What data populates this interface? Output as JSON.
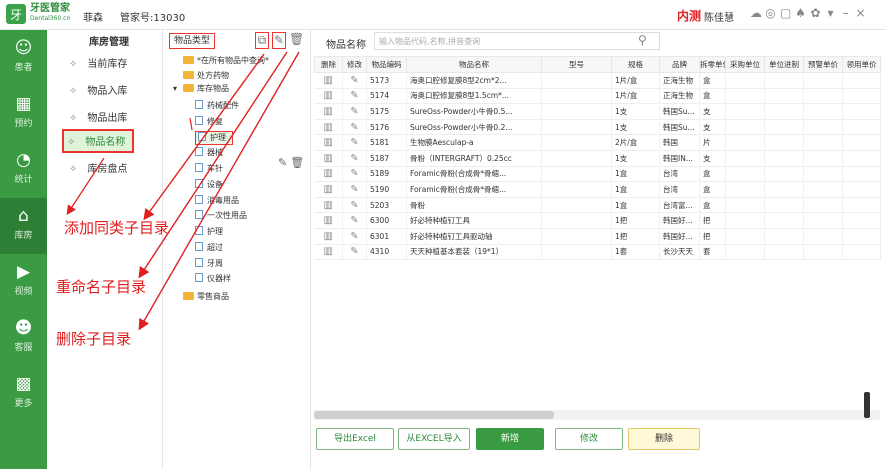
{
  "titlebar": {
    "logo_mark": "牙",
    "logo_name": "牙医管家",
    "logo_domain": "Dental360.cn",
    "user_name": "菲森",
    "manager_id": "管家号:13030",
    "net_status": "内测",
    "account_name": "陈佳慧",
    "icons": [
      "chat-icon",
      "camera-icon",
      "screen-icon",
      "bell-icon",
      "settings-icon",
      "dropdown-icon",
      "minimize-icon",
      "close-icon"
    ]
  },
  "sidebar": {
    "items": [
      {
        "label": "患者",
        "icon": "person-icon",
        "glyph": "☺"
      },
      {
        "label": "预约",
        "icon": "calendar-icon",
        "glyph": "▦"
      },
      {
        "label": "统计",
        "icon": "pie-icon",
        "glyph": "◔"
      },
      {
        "label": "库房",
        "icon": "warehouse-icon",
        "glyph": "⌂"
      },
      {
        "label": "视频",
        "icon": "play-icon",
        "glyph": "▶"
      },
      {
        "label": "客服",
        "icon": "service-icon",
        "glyph": "☻"
      },
      {
        "label": "更多",
        "icon": "grid-icon",
        "glyph": "▩"
      }
    ]
  },
  "menu": {
    "title": "库房管理",
    "items": [
      "当前库存",
      "物品入库",
      "物品出库",
      "物品名称",
      "库房盘点"
    ]
  },
  "tree": {
    "title": "物品类型",
    "nodes": [
      {
        "label": "*在所有物品中查询*",
        "kind": "folder"
      },
      {
        "label": "处方药物",
        "kind": "folder"
      },
      {
        "label": "库存物品",
        "kind": "folder"
      },
      {
        "label": "药械配件",
        "kind": "file"
      },
      {
        "label": "修复",
        "kind": "file"
      },
      {
        "label": "护理",
        "kind": "file"
      },
      {
        "label": "器械",
        "kind": "file"
      },
      {
        "label": "车针",
        "kind": "file"
      },
      {
        "label": "设备",
        "kind": "file"
      },
      {
        "label": "消毒用品",
        "kind": "file"
      },
      {
        "label": "一次性用品",
        "kind": "file"
      },
      {
        "label": "护理",
        "kind": "file"
      },
      {
        "label": "超过",
        "kind": "file"
      },
      {
        "label": "牙周",
        "kind": "file"
      },
      {
        "label": "仪器样",
        "kind": "file"
      },
      {
        "label": "零售商品",
        "kind": "folder"
      }
    ]
  },
  "search": {
    "label": "物品名称",
    "placeholder": "输入物品代码,名称,拼音查询"
  },
  "table": {
    "columns": [
      "删除",
      "修改",
      "物品编码",
      "物品名称",
      "型号",
      "规格",
      "品牌",
      "拆零单位",
      "采购单位",
      "单位进制",
      "预警单价",
      "领用单价"
    ],
    "rows": [
      {
        "code": "5173",
        "name": "海奥口腔修复膜8型2cm*2...",
        "model": "",
        "spec": "1片/盒",
        "brand": "正海生物",
        "unit": "盒"
      },
      {
        "code": "5174",
        "name": "海奥口腔修复膜8型1.5cm*...",
        "model": "",
        "spec": "1片/盒",
        "brand": "正海生物",
        "unit": "盒"
      },
      {
        "code": "5175",
        "name": "SureOss-Powder小牛骨0.5...",
        "model": "",
        "spec": "1支",
        "brand": "韩国Su...",
        "unit": "支"
      },
      {
        "code": "5176",
        "name": "SureOss-Powder小牛骨0.2...",
        "model": "",
        "spec": "1支",
        "brand": "韩国Su...",
        "unit": "支"
      },
      {
        "code": "5181",
        "name": "生物膜Aesculap-a",
        "model": "",
        "spec": "2片/盒",
        "brand": "韩国",
        "unit": "片"
      },
      {
        "code": "5187",
        "name": "骨粉（INTERGRAFT）0.25cc",
        "model": "",
        "spec": "1支",
        "brand": "韩国IN...",
        "unit": "支"
      },
      {
        "code": "5189",
        "name": "Foramic骨粉(合成骨*骨缩...",
        "model": "",
        "spec": "1盒",
        "brand": "台湾",
        "unit": "盒"
      },
      {
        "code": "5190",
        "name": "Foramic骨粉(合成骨*骨缩...",
        "model": "",
        "spec": "1盒",
        "brand": "台湾",
        "unit": "盒"
      },
      {
        "code": "5203",
        "name": "骨粉",
        "model": "",
        "spec": "1盒",
        "brand": "台湾富...",
        "unit": "盒"
      },
      {
        "code": "6300",
        "name": "好必特种植钉工具",
        "model": "",
        "spec": "1把",
        "brand": "韩国好...",
        "unit": "把"
      },
      {
        "code": "6301",
        "name": "好必特种植钉工具驱动轴",
        "model": "",
        "spec": "1把",
        "brand": "韩国好...",
        "unit": "把"
      },
      {
        "code": "4310",
        "name": "天天种植基本套装（19*1）",
        "model": "",
        "spec": "1套",
        "brand": "长沙天天",
        "unit": "套"
      }
    ]
  },
  "actions": {
    "export_excel": "导出Excel",
    "import_excel": "从EXCEL导入",
    "add": "新增",
    "edit": "修改",
    "delete": "删除"
  },
  "annotations": {
    "add_sibling": "添加同类子目录",
    "rename": "重命名子目录",
    "delete_child": "删除子目录"
  },
  "colors": {
    "brand_green": "#3b9b43",
    "annotation_red": "#e02020"
  }
}
